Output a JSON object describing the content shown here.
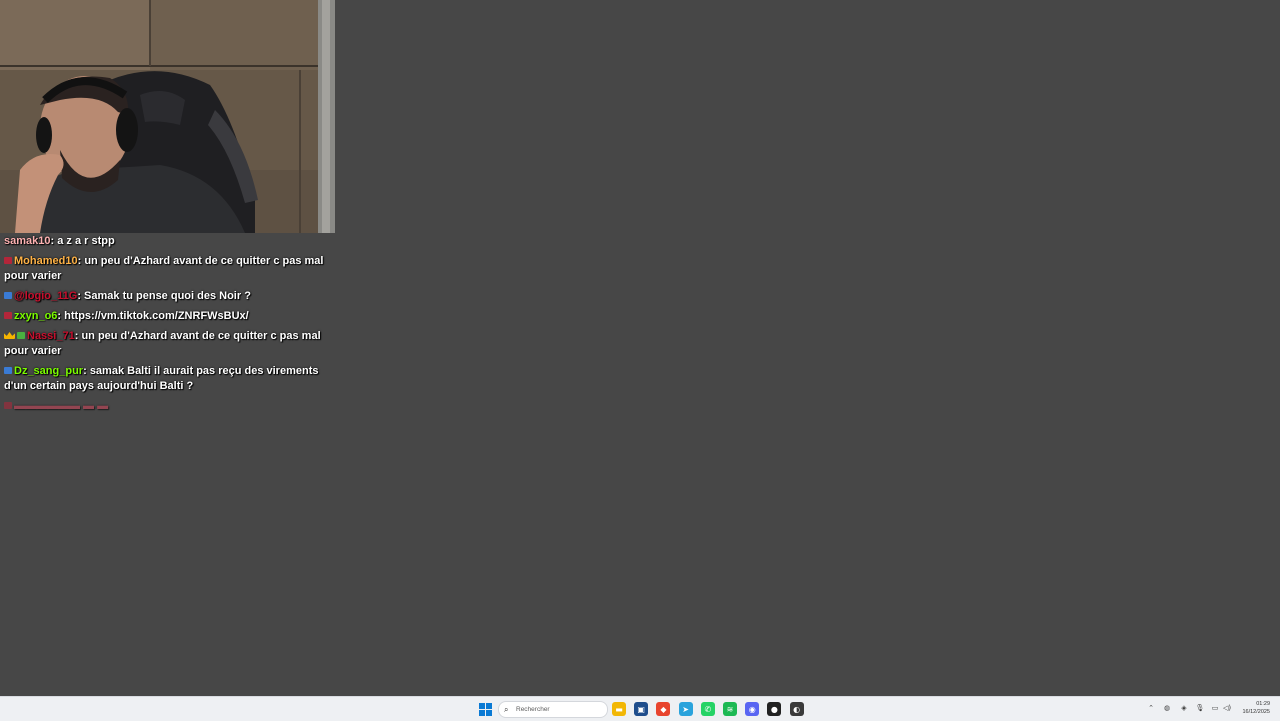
{
  "chat": {
    "messages": [
      {
        "badges": [],
        "user": "samak10",
        "user_color": "#ffb3b3",
        "text": "a z a r stpp"
      },
      {
        "badges": [
          "red"
        ],
        "user": "Mohamed10",
        "user_color": "#ffb347",
        "text": "un peu d'Azhard avant de ce quitter c pas mal pour varier"
      },
      {
        "badges": [
          "blue"
        ],
        "user": "@logio_11G",
        "user_color": "#c8102e",
        "text": "Samak tu pense quoi des Noir ?"
      },
      {
        "badges": [
          "red"
        ],
        "user": "zxyn_o6",
        "user_color": "#7cfc00",
        "text": "https://vm.tiktok.com/ZNRFWsBUx/"
      },
      {
        "badges": [
          "crown",
          "green"
        ],
        "user": "Nassi_71",
        "user_color": "#c8102e",
        "text": "un peu d'Azhard avant de ce quitter c pas mal pour varier"
      },
      {
        "badges": [
          "blue"
        ],
        "user": "Dz_sang_pur",
        "user_color": "#7cfc00",
        "text": "samak Balti il aurait pas reçu des virements d'un certain pays aujourd'hui Balti ?"
      }
    ]
  },
  "taskbar": {
    "search_placeholder": "Rechercher",
    "pinned": [
      {
        "name": "file-explorer-icon",
        "color": "#f2b705",
        "glyph": "▬"
      },
      {
        "name": "store-icon",
        "color": "#1e4d8c",
        "glyph": "▣"
      },
      {
        "name": "brave-icon",
        "color": "#e8442e",
        "glyph": "◆"
      },
      {
        "name": "telegram-icon",
        "color": "#2aa3dc",
        "glyph": "➤"
      },
      {
        "name": "whatsapp-icon",
        "color": "#25d366",
        "glyph": "✆"
      },
      {
        "name": "spotify-icon",
        "color": "#1db954",
        "glyph": "≋"
      },
      {
        "name": "discord-icon",
        "color": "#5865f2",
        "glyph": "◉"
      },
      {
        "name": "app-icon-red-dot",
        "color": "#222222",
        "glyph": "●"
      },
      {
        "name": "obs-icon",
        "color": "#3a3a3a",
        "glyph": "◐"
      }
    ],
    "clock_time": "01:29",
    "clock_date": "16/12/2025"
  }
}
